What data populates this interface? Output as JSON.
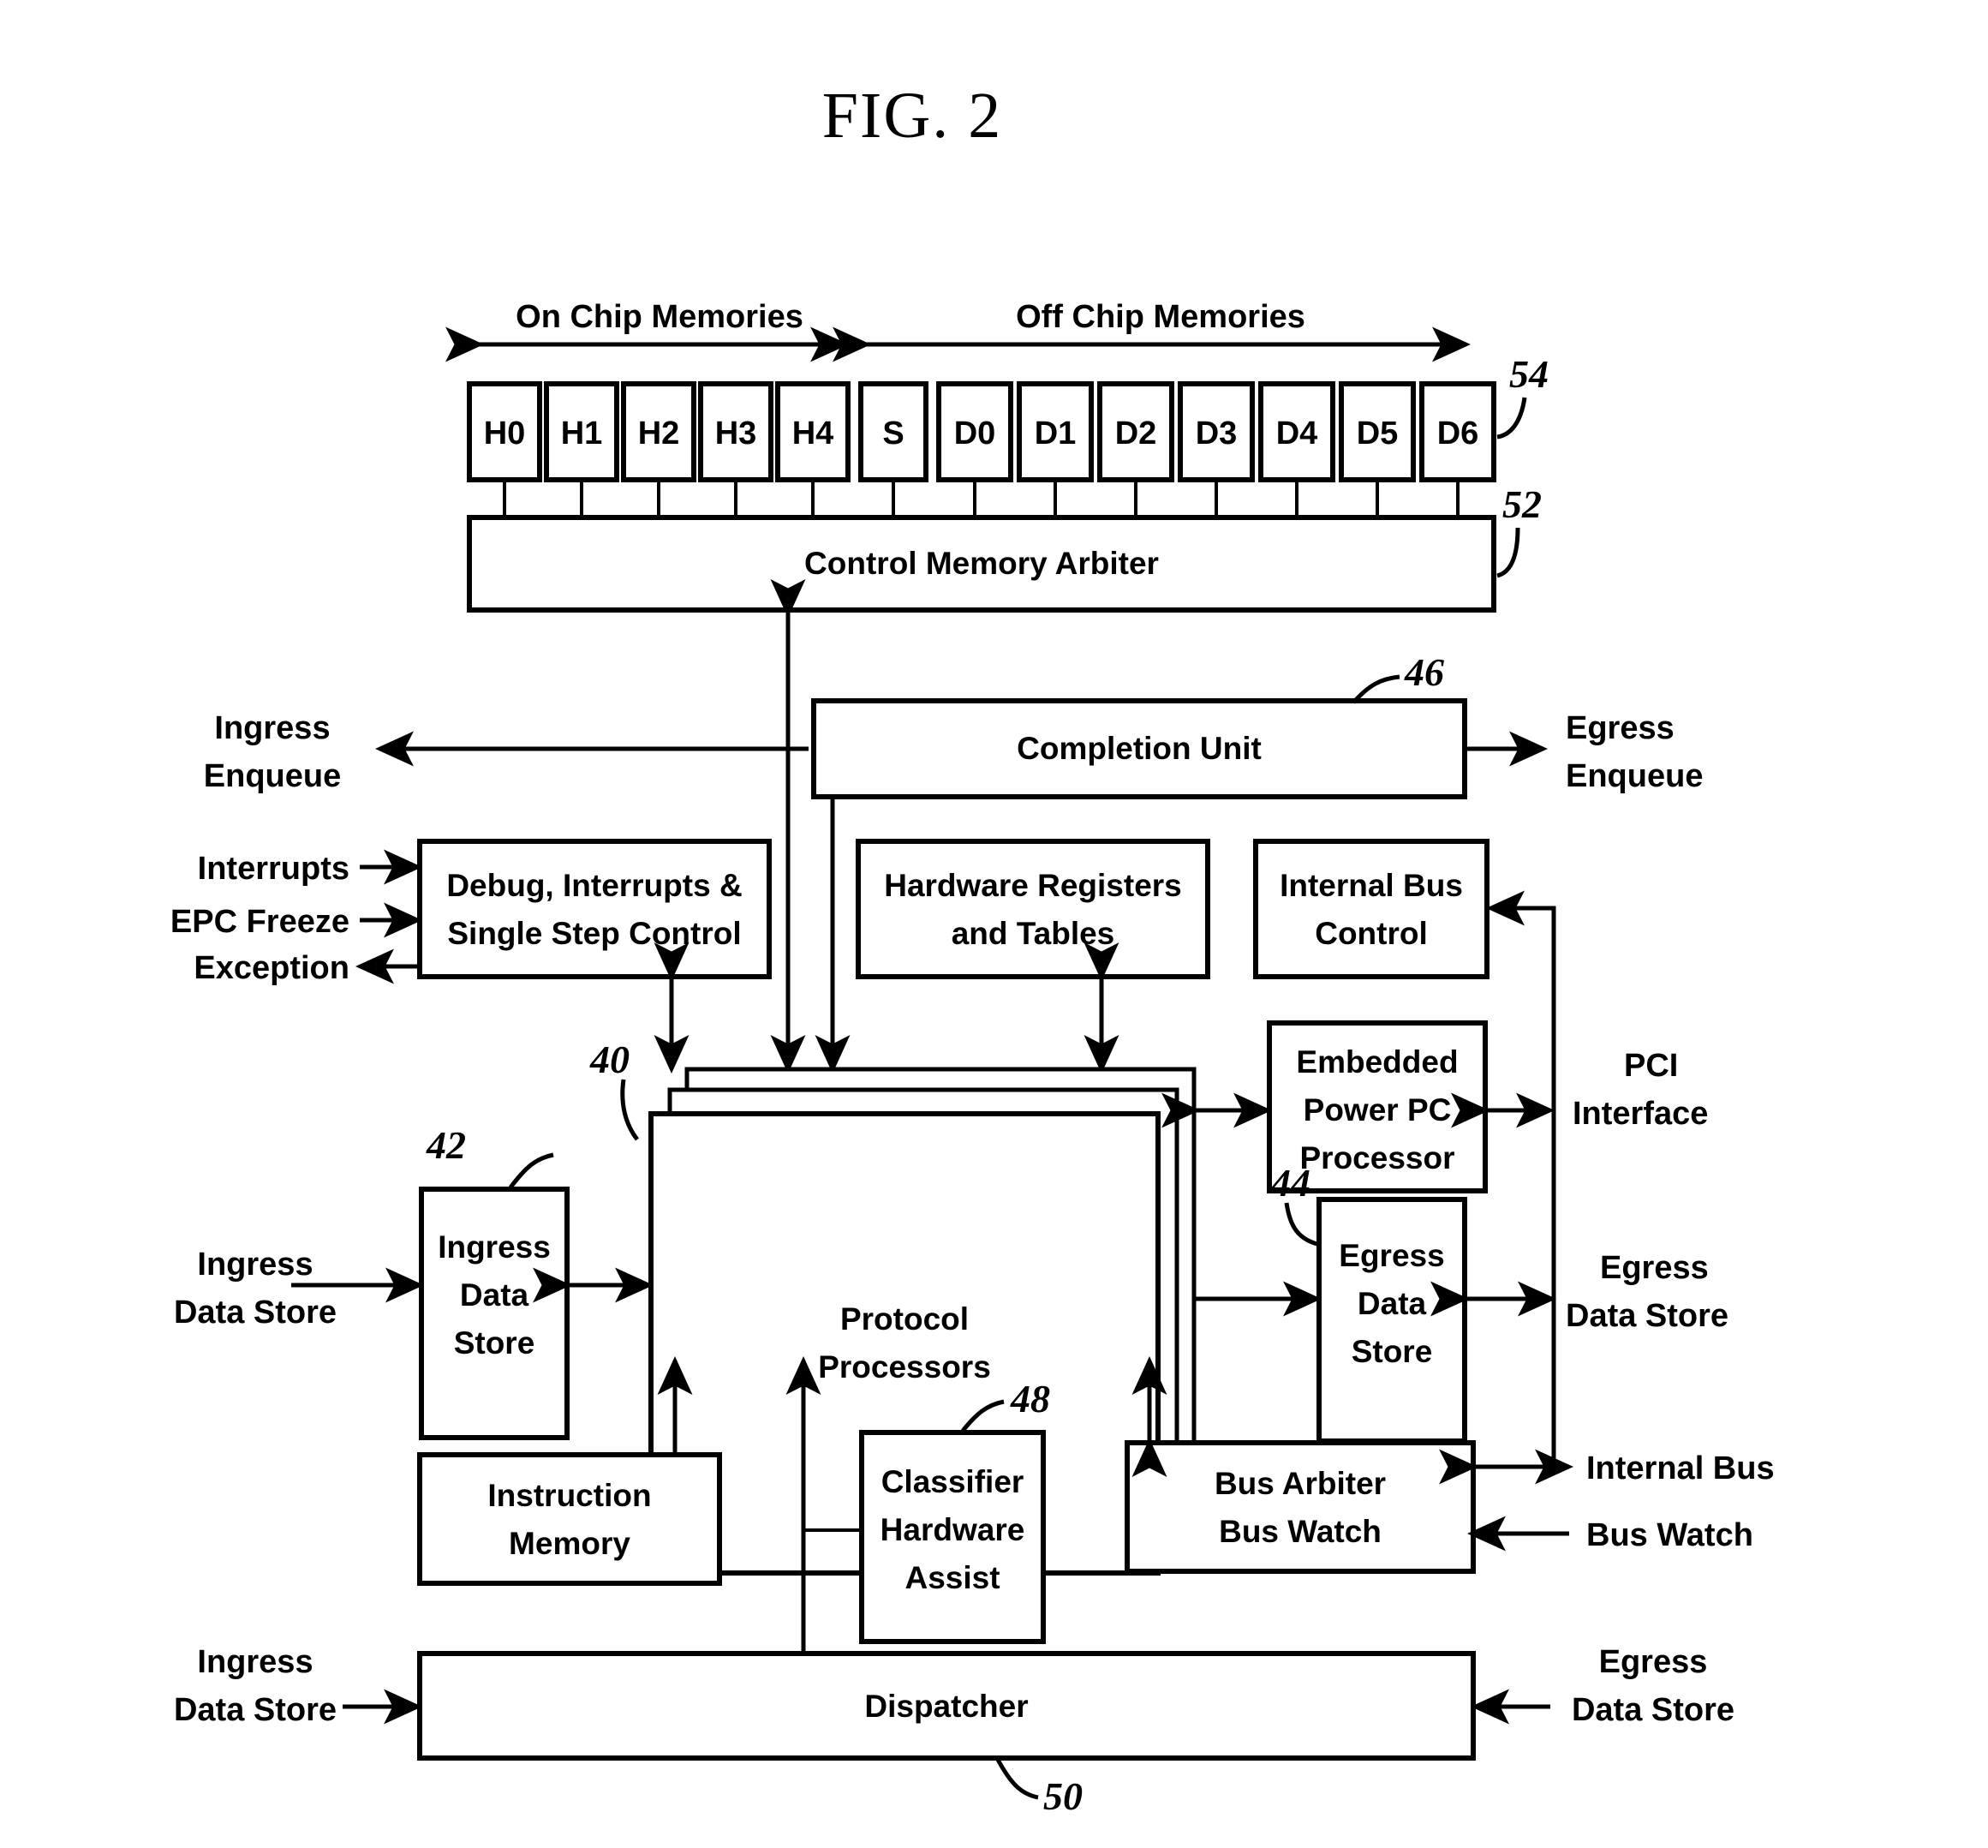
{
  "figure": {
    "title": "FIG. 2",
    "span_labels": {
      "on_chip": "On Chip Memories",
      "off_chip": "Off Chip Memories"
    },
    "memories": [
      {
        "label": "H0",
        "group": "on-chip"
      },
      {
        "label": "H1",
        "group": "on-chip"
      },
      {
        "label": "H2",
        "group": "on-chip"
      },
      {
        "label": "H3",
        "group": "on-chip"
      },
      {
        "label": "H4",
        "group": "on-chip"
      },
      {
        "label": "S",
        "group": "off-chip"
      },
      {
        "label": "D0",
        "group": "off-chip"
      },
      {
        "label": "D1",
        "group": "off-chip"
      },
      {
        "label": "D2",
        "group": "off-chip"
      },
      {
        "label": "D3",
        "group": "off-chip"
      },
      {
        "label": "D4",
        "group": "off-chip"
      },
      {
        "label": "D5",
        "group": "off-chip"
      },
      {
        "label": "D6",
        "group": "off-chip"
      }
    ],
    "blocks": {
      "control_memory_arbiter": "Control Memory Arbiter",
      "completion_unit": "Completion Unit",
      "debug_interrupts_l1": "Debug, Interrupts &",
      "debug_interrupts_l2": "Single Step Control",
      "hardware_registers_l1": "Hardware Registers",
      "hardware_registers_l2": "and Tables",
      "internal_bus_control_l1": "Internal Bus",
      "internal_bus_control_l2": "Control",
      "protocol_processors_l1": "Protocol",
      "protocol_processors_l2": "Processors",
      "embedded_ppc_l1": "Embedded",
      "embedded_ppc_l2": "Power PC",
      "embedded_ppc_l3": "Processor",
      "ingress_data_store_l1": "Ingress",
      "ingress_data_store_l2": "Data",
      "ingress_data_store_l3": "Store",
      "egress_data_store_l1": "Egress",
      "egress_data_store_l2": "Data",
      "egress_data_store_l3": "Store",
      "instruction_memory_l1": "Instruction",
      "instruction_memory_l2": "Memory",
      "classifier_l1": "Classifier",
      "classifier_l2": "Hardware",
      "classifier_l3": "Assist",
      "bus_arbiter_l1": "Bus Arbiter",
      "bus_arbiter_l2": "Bus Watch",
      "dispatcher": "Dispatcher"
    },
    "external_labels": {
      "ingress_enqueue_l1": "Ingress",
      "ingress_enqueue_l2": "Enqueue",
      "egress_enqueue_l1": "Egress",
      "egress_enqueue_l2": "Enqueue",
      "interrupts": "Interrupts",
      "epc_freeze": "EPC Freeze",
      "exception": "Exception",
      "pci_interface_l1": "PCI",
      "pci_interface_l2": "Interface",
      "ingress_data_store_in_l1": "Ingress",
      "ingress_data_store_in_l2": "Data Store",
      "egress_data_store_out_l1": "Egress",
      "egress_data_store_out_l2": "Data Store",
      "internal_bus": "Internal Bus",
      "bus_watch": "Bus Watch",
      "dispatcher_in_l1": "Ingress",
      "dispatcher_in_l2": "Data Store",
      "dispatcher_out_l1": "Egress",
      "dispatcher_out_l2": "Data Store"
    },
    "reference_numerals": {
      "n40": "40",
      "n42": "42",
      "n44": "44",
      "n46": "46",
      "n48": "48",
      "n50": "50",
      "n52": "52",
      "n54": "54"
    },
    "colors": {
      "ink": "#000000",
      "paper": "#ffffff"
    }
  }
}
